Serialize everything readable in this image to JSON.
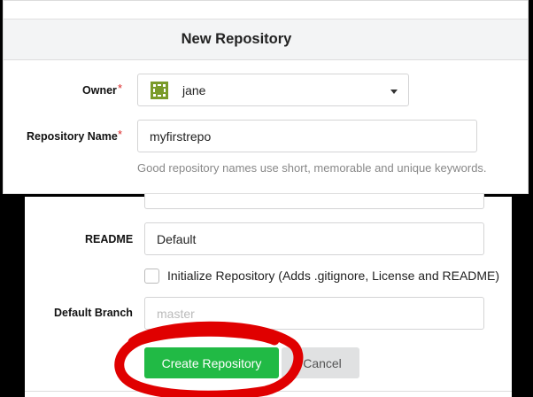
{
  "form": {
    "title": "New Repository",
    "owner": {
      "label": "Owner",
      "required_mark": "*",
      "value": "jane"
    },
    "repo_name": {
      "label": "Repository Name",
      "required_mark": "*",
      "value": "myfirstrepo",
      "hint": "Good repository names use short, memorable and unique keywords."
    },
    "readme": {
      "label": "README",
      "value": "Default"
    },
    "init_repo": {
      "label": "Initialize Repository (Adds .gitignore, License and README)",
      "checked": false
    },
    "default_branch": {
      "label": "Default Branch",
      "placeholder": "master"
    },
    "buttons": {
      "create": "Create Repository",
      "cancel": "Cancel"
    }
  },
  "colors": {
    "primary_button": "#21ba45",
    "annotation_circle": "#e00000",
    "required": "#db2828"
  },
  "icons": {
    "owner_avatar": "identicon-avatar",
    "dropdown": "caret-down-icon"
  }
}
